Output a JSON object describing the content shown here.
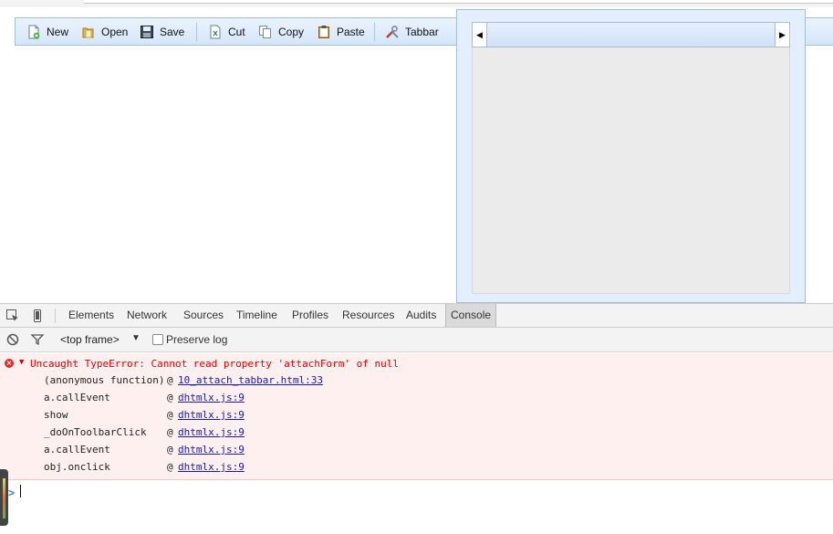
{
  "toolbar": {
    "items": [
      {
        "label": "New",
        "icon": "new-document-icon"
      },
      {
        "label": "Open",
        "icon": "open-folder-icon"
      },
      {
        "label": "Save",
        "icon": "save-disk-icon"
      },
      {
        "label": "Cut",
        "icon": "cut-icon"
      },
      {
        "label": "Copy",
        "icon": "copy-icon"
      },
      {
        "label": "Paste",
        "icon": "paste-icon"
      },
      {
        "label": "Tabbar",
        "icon": "tools-icon"
      }
    ]
  },
  "popup": {
    "tabbar": {
      "left_arrow": "◀",
      "right_arrow": "▶"
    }
  },
  "devtools": {
    "tabs": [
      "Elements",
      "Network",
      "Sources",
      "Timeline",
      "Profiles",
      "Resources",
      "Audits",
      "Console"
    ],
    "active_tab": "Console",
    "console_toolbar": {
      "frame": "<top frame>",
      "preserve_log": "Preserve log",
      "preserve_log_checked": false
    },
    "error": {
      "message": "Uncaught TypeError: Cannot read property 'attachForm' of null",
      "stack": [
        {
          "fn": "(anonymous function)",
          "at": "@",
          "link": "10_attach_tabbar.html:33"
        },
        {
          "fn": "a.callEvent",
          "at": "@",
          "link": "dhtmlx.js:9"
        },
        {
          "fn": "show",
          "at": "@",
          "link": "dhtmlx.js:9"
        },
        {
          "fn": "_doOnToolbarClick",
          "at": "@",
          "link": "dhtmlx.js:9"
        },
        {
          "fn": "a.callEvent",
          "at": "@",
          "link": "dhtmlx.js:9"
        },
        {
          "fn": "obj.onclick",
          "at": "@",
          "link": "dhtmlx.js:9"
        }
      ]
    },
    "prompt": ">"
  },
  "colors": {
    "toolbar_bg": "#d5e6fa",
    "error_text": "#e00000",
    "link": "#1a1aa6",
    "error_bg": "#fff0f0"
  }
}
